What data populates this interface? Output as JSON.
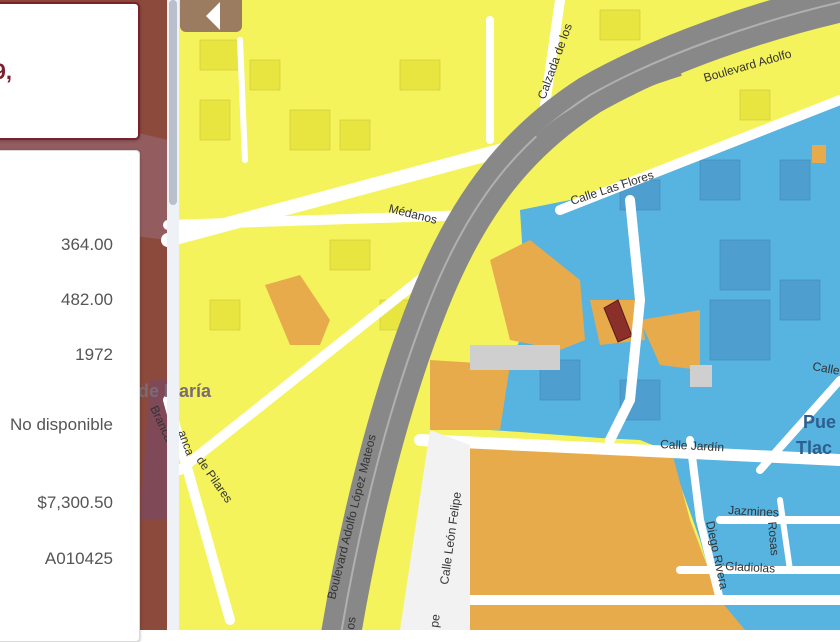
{
  "info_panel": {
    "address_fragment": "9,",
    "values": [
      "364.00",
      "482.00",
      "1972",
      "No disponible",
      "$7,300.50",
      "A010425"
    ]
  },
  "map": {
    "streets": {
      "calzada": "Calzada de los",
      "boulevard_top": "Boulevard Adolfo",
      "medanos": "Médanos",
      "las_flores": "Calle Las Flores",
      "blvd_lopez": "Boulevard Adolfo López Mateos",
      "pilares": "de Pilares",
      "leon_felipe": "Calle León Felipe",
      "jardin": "Calle Jardín",
      "jazmines": "Jazmines",
      "diego_rivera": "Diego Rivera",
      "rosas": "Rosas",
      "gladiolas": "Gladiolas",
      "calle_right": "Calle",
      "branca": "Branca",
      "francia": "anca",
      "bottom_left": "pe",
      "bottom_road": "os"
    },
    "districts": {
      "left": "de María",
      "right_line1": "Pue",
      "right_line2": "Tlac"
    },
    "colors": {
      "residential": "#f5f35c",
      "commercial": "#57b3e0",
      "mixed": "#e8ab4c",
      "highlighted_parcel": "#8b2f2a",
      "highway": "#888888"
    },
    "icons": [
      "chevron-left-icon"
    ]
  }
}
